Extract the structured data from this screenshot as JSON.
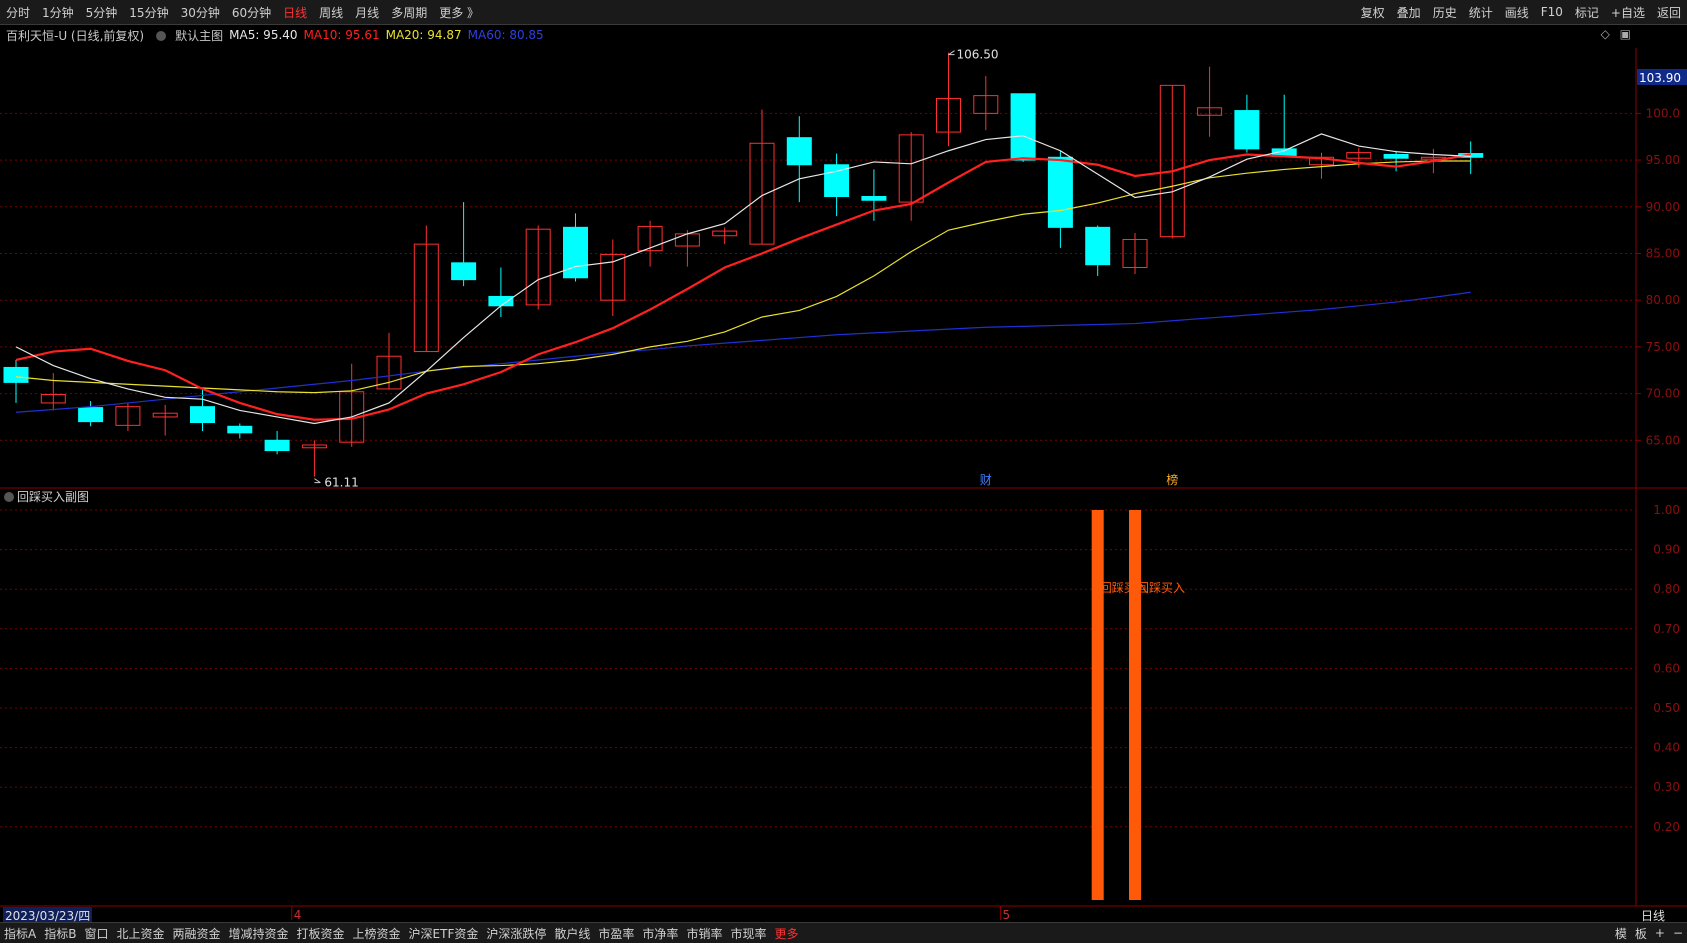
{
  "toolbar": {
    "periods": [
      "分时",
      "1分钟",
      "5分钟",
      "15分钟",
      "30分钟",
      "60分钟",
      "日线",
      "周线",
      "月线",
      "多周期",
      "更多 》"
    ],
    "active_period": "日线",
    "tools": [
      "复权",
      "叠加",
      "历史",
      "统计",
      "画线",
      "F10",
      "标记",
      "+自选",
      "返回"
    ]
  },
  "main_chart": {
    "stock_title": "百利天恒-U (日线,前复权)",
    "template_name": "默认主图",
    "ma5": "MA5: 95.40",
    "ma10": "MA10: 95.61",
    "ma20": "MA20: 94.87",
    "ma60": "MA60: 80.85",
    "colors": {
      "ma5": "#e6e6e6",
      "ma10": "#ff2020",
      "ma20": "#e8e030",
      "ma60": "#2030d0",
      "up": "#ff3030",
      "down": "#00ffff",
      "grid": "#7a0000"
    },
    "last_price_tag": "103.90",
    "high_marker": "106.50",
    "low_marker": "61.11",
    "price_ticks": [
      "100.0",
      "95.00",
      "90.00",
      "85.00",
      "80.00",
      "75.00",
      "70.00",
      "65.00"
    ],
    "event_markers": [
      "财",
      "榜"
    ]
  },
  "chart_data": {
    "type": "candlestick",
    "x_start": "2023/03/23",
    "candles": [
      [
        72.8,
        71.2,
        73.6,
        69.0
      ],
      [
        69.0,
        69.9,
        72.2,
        68.2
      ],
      [
        68.5,
        67.0,
        69.2,
        66.5
      ],
      [
        66.6,
        68.6,
        69.0,
        66.0
      ],
      [
        67.5,
        67.9,
        68.8,
        65.5
      ],
      [
        68.6,
        66.9,
        70.5,
        66.0
      ],
      [
        66.5,
        65.8,
        66.8,
        65.2
      ],
      [
        65.0,
        63.9,
        66.0,
        63.5
      ],
      [
        64.2,
        64.5,
        65.0,
        61.11
      ],
      [
        64.8,
        70.2,
        73.2,
        64.3
      ],
      [
        70.5,
        74.0,
        76.5,
        70.5
      ],
      [
        74.5,
        86.0,
        88.0,
        74.5
      ],
      [
        84.0,
        82.2,
        90.5,
        81.5
      ],
      [
        80.4,
        79.4,
        83.5,
        78.2
      ],
      [
        79.5,
        87.6,
        88.0,
        79.0
      ],
      [
        87.8,
        82.4,
        89.3,
        82.0
      ],
      [
        80.0,
        84.9,
        86.5,
        78.3
      ],
      [
        85.3,
        87.9,
        88.5,
        83.6
      ],
      [
        85.8,
        87.1,
        87.5,
        83.6
      ],
      [
        86.9,
        87.4,
        87.8,
        86.0
      ],
      [
        86.0,
        96.8,
        100.4,
        86.0
      ],
      [
        97.4,
        94.5,
        99.7,
        90.5
      ],
      [
        94.5,
        91.1,
        95.7,
        89.0
      ],
      [
        91.1,
        90.7,
        94.0,
        88.5
      ],
      [
        90.5,
        97.7,
        98.0,
        88.5
      ],
      [
        98.0,
        101.6,
        106.5,
        96.5
      ],
      [
        100.0,
        101.9,
        104.0,
        98.2
      ],
      [
        102.1,
        95.0,
        102.1,
        94.8
      ],
      [
        95.3,
        87.8,
        96.0,
        85.6
      ],
      [
        87.8,
        83.8,
        88.0,
        82.6
      ],
      [
        83.5,
        86.5,
        87.2,
        82.8
      ],
      [
        86.8,
        103.0,
        103.0,
        86.6
      ],
      [
        99.8,
        100.6,
        105.0,
        97.5
      ],
      [
        100.3,
        96.2,
        102.0,
        95.8
      ],
      [
        96.2,
        95.4,
        102.0,
        95.3
      ],
      [
        94.5,
        95.3,
        95.8,
        93.0
      ],
      [
        95.2,
        95.8,
        96.3,
        94.2
      ],
      [
        95.6,
        95.2,
        96.0,
        93.8
      ],
      [
        95.1,
        95.3,
        96.2,
        93.6
      ],
      [
        95.7,
        95.3,
        97.0,
        93.5
      ]
    ],
    "ma5": [
      75.0,
      73.0,
      71.6,
      70.5,
      69.6,
      69.4,
      68.2,
      67.5,
      66.8,
      67.5,
      69.0,
      72.4,
      76.0,
      79.4,
      82.2,
      83.6,
      84.1,
      85.6,
      87.1,
      88.2,
      91.2,
      93.0,
      93.8,
      94.8,
      94.6,
      96.0,
      97.2,
      97.6,
      96.0,
      93.5,
      91.0,
      91.6,
      93.2,
      95.1,
      96.0,
      97.8,
      96.5,
      95.9,
      95.6,
      95.4
    ],
    "ma10": [
      73.6,
      74.5,
      74.8,
      73.5,
      72.5,
      70.5,
      69.0,
      67.8,
      67.2,
      67.3,
      68.3,
      70.0,
      71.0,
      72.3,
      74.2,
      75.5,
      77.0,
      79.0,
      81.2,
      83.5,
      85.0,
      86.6,
      88.1,
      89.6,
      90.3,
      92.6,
      94.8,
      95.2,
      95.0,
      94.5,
      93.3,
      93.8,
      95.0,
      95.6,
      95.4,
      95.2,
      94.7,
      94.3,
      94.9,
      95.6
    ],
    "ma20": [
      71.8,
      71.4,
      71.2,
      71.0,
      70.8,
      70.6,
      70.4,
      70.2,
      70.1,
      70.3,
      71.2,
      72.4,
      72.9,
      73.0,
      73.2,
      73.6,
      74.2,
      75.0,
      75.6,
      76.6,
      78.2,
      78.9,
      80.4,
      82.6,
      85.2,
      87.5,
      88.4,
      89.2,
      89.6,
      90.4,
      91.4,
      92.2,
      93.1,
      93.6,
      94.0,
      94.3,
      94.6,
      94.8,
      94.9,
      94.9
    ],
    "ma60": [
      68.0,
      68.3,
      68.6,
      69.0,
      69.4,
      69.8,
      70.2,
      70.6,
      71.0,
      71.4,
      71.9,
      72.4,
      72.8,
      73.2,
      73.6,
      74.0,
      74.4,
      74.7,
      75.1,
      75.4,
      75.7,
      76.0,
      76.3,
      76.5,
      76.7,
      76.9,
      77.1,
      77.2,
      77.3,
      77.4,
      77.5,
      77.8,
      78.1,
      78.4,
      78.7,
      79.0,
      79.4,
      79.8,
      80.3,
      80.85
    ],
    "price_range": [
      60,
      107
    ],
    "indicator": {
      "name": "回踩买入副图",
      "signal_label": "回踩买入",
      "signal_indices": [
        29,
        30
      ],
      "values": [
        0,
        0,
        0,
        0,
        0,
        0,
        0,
        0,
        0,
        0,
        0,
        0,
        0,
        0,
        0,
        0,
        0,
        0,
        0,
        0,
        0,
        0,
        0,
        0,
        0,
        0,
        0,
        0,
        0,
        1,
        1,
        0,
        0,
        0,
        0,
        0,
        0,
        0,
        0,
        0
      ],
      "ticks": [
        "1.00",
        "0.90",
        "0.80",
        "0.70",
        "0.60",
        "0.50",
        "0.40",
        "0.30",
        "0.20"
      ],
      "range": [
        0,
        1
      ],
      "bar_color": "#ff5a0a"
    },
    "x_month_labels": [
      {
        "index": 7,
        "label": "4"
      },
      {
        "index": 26,
        "label": "5"
      }
    ]
  },
  "footer": {
    "date_label": "2023/03/23/四",
    "period_label": "日线",
    "tabs": [
      "指标A",
      "指标B",
      "窗口",
      "北上资金",
      "两融资金",
      "增减持资金",
      "打板资金",
      "上榜资金",
      "沪深ETF资金",
      "沪深涨跌停",
      "散户线",
      "市盈率",
      "市净率",
      "市销率",
      "市现率",
      "更多"
    ],
    "right_items": [
      "模",
      "板",
      "+",
      "−"
    ]
  }
}
